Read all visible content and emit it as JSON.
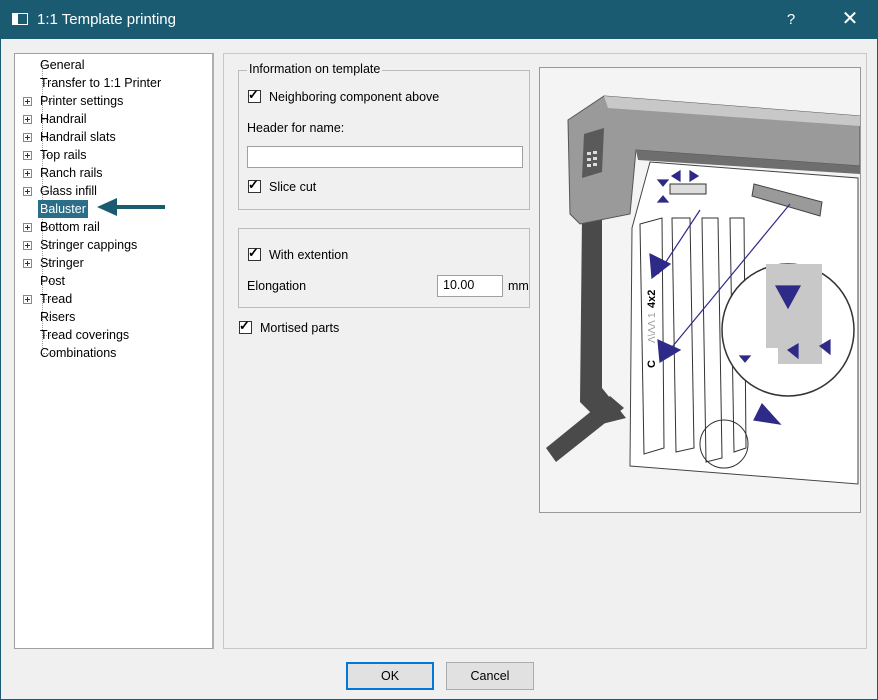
{
  "window": {
    "title": "1:1 Template printing",
    "help_label": "?",
    "close_label": "✕"
  },
  "tree": {
    "items": [
      {
        "label": "General",
        "expandable": false
      },
      {
        "label": "Transfer to 1:1 Printer",
        "expandable": false
      },
      {
        "label": "Printer settings",
        "expandable": true
      },
      {
        "label": "Handrail",
        "expandable": true
      },
      {
        "label": "Handrail slats",
        "expandable": true
      },
      {
        "label": "Top rails",
        "expandable": true
      },
      {
        "label": "Ranch rails",
        "expandable": true
      },
      {
        "label": "Glass infill",
        "expandable": true
      },
      {
        "label": "Baluster",
        "expandable": false,
        "selected": true
      },
      {
        "label": "Bottom rail",
        "expandable": true
      },
      {
        "label": "Stringer cappings",
        "expandable": true
      },
      {
        "label": "Stringer",
        "expandable": true
      },
      {
        "label": "Post",
        "expandable": false
      },
      {
        "label": "Tread",
        "expandable": true
      },
      {
        "label": "Risers",
        "expandable": false
      },
      {
        "label": "Tread coverings",
        "expandable": false
      },
      {
        "label": "Combinations",
        "expandable": false
      }
    ]
  },
  "info_group": {
    "title": "Information on template",
    "neighboring_label": "Neighboring component above",
    "neighboring_checked": true,
    "header_label": "Header for name:",
    "header_value": "",
    "slice_label": "Slice cut",
    "slice_checked": true
  },
  "extension_group": {
    "with_extension_label": "With extention",
    "with_extension_checked": true,
    "elongation_label": "Elongation",
    "elongation_value": "10.00",
    "elongation_unit": "mm"
  },
  "mortised": {
    "label": "Mortised parts",
    "checked": true
  },
  "preview": {
    "template_text_1": "4x2",
    "template_text_2": "C",
    "template_text_3": "Λ\\ΛΛ 1"
  },
  "buttons": {
    "ok": "OK",
    "cancel": "Cancel"
  },
  "colors": {
    "titlebar": "#1b5b72",
    "selection": "#2a6e8a",
    "arrow": "#1b5b72",
    "diagram_arrow": "#2e2a88"
  }
}
